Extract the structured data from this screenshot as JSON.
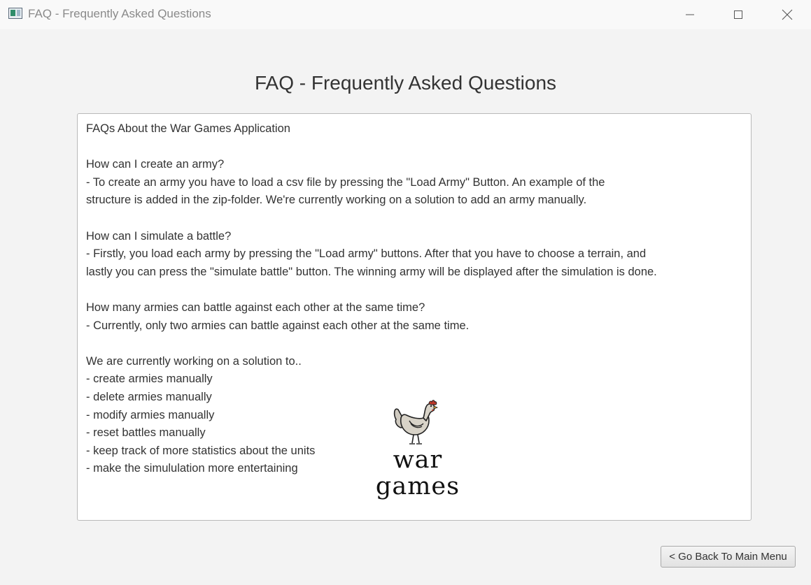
{
  "window": {
    "title": "FAQ - Frequently Asked Questions",
    "icon": "app-window-icon",
    "controls": [
      "minimize-icon",
      "maximize-icon",
      "close-icon"
    ]
  },
  "page": {
    "heading": "FAQ - Frequently Asked Questions"
  },
  "faq": {
    "text": "FAQs About the War Games Application\n\nHow can I create an army?\n- To create an army you have to load a csv file by pressing the \"Load Army\" Button. An example of the\nstructure is added in the zip-folder. We're currently working on a solution to add an army manually.\n\nHow can I simulate a battle?\n- Firstly, you load each army by pressing the \"Load army\" buttons. After that you have to choose a terrain, and\nlastly you can press the \"simulate battle\" button. The winning army will be displayed after the simulation is done.\n\nHow many armies can battle against each other at the same time?\n- Currently, only two armies can battle against each other at the same time.\n\nWe are currently working on a solution to..\n- create armies manually\n- delete armies manually\n- modify armies manually\n- reset battles manually\n- keep track of more statistics about the units\n- make the simululation more entertaining"
  },
  "logo": {
    "icon": "chicken-icon",
    "line1": "war",
    "line2": "games"
  },
  "footer": {
    "back_button_label": "< Go Back To Main Menu"
  },
  "colors": {
    "background": "#f3f3f3",
    "panel": "#ffffff",
    "border": "#b9b9b9",
    "text": "#333333",
    "comb": "#c0392b"
  }
}
